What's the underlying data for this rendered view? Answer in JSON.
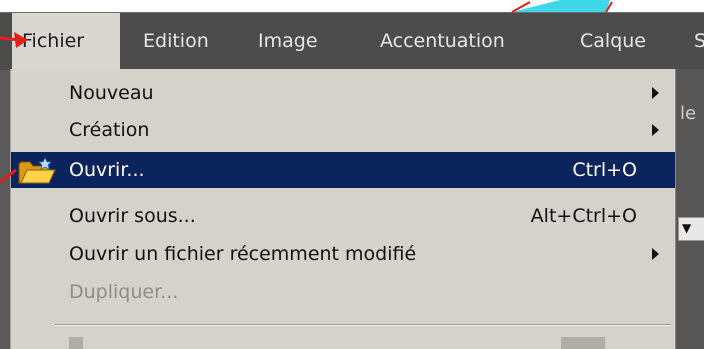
{
  "menubar": {
    "items": [
      {
        "label": "Fichier",
        "active": true
      },
      {
        "label": "Edition"
      },
      {
        "label": "Image"
      },
      {
        "label": "Accentuation"
      },
      {
        "label": "Calque"
      },
      {
        "label": "S"
      }
    ]
  },
  "background": {
    "panel_fragment": "le"
  },
  "dropdown": {
    "items": [
      {
        "label": "Nouveau",
        "submenu": true
      },
      {
        "label": "Création",
        "submenu": true
      },
      {
        "label": "Ouvrir...",
        "shortcut": "Ctrl+O",
        "highlighted": true,
        "icon": "folder-open-icon"
      },
      {
        "label": "Ouvrir sous...",
        "shortcut": "Alt+Ctrl+O"
      },
      {
        "label": "Ouvrir un fichier récemment modifié",
        "submenu": true
      },
      {
        "label": "Dupliquer...",
        "disabled": true
      }
    ]
  },
  "colors": {
    "menubar_bg": "#4c4c4c",
    "menu_bg": "#d5d2cb",
    "highlight": "#0c245c",
    "annotation_red": "#e0201a",
    "annotation_cyan": "#3fd7e8"
  }
}
